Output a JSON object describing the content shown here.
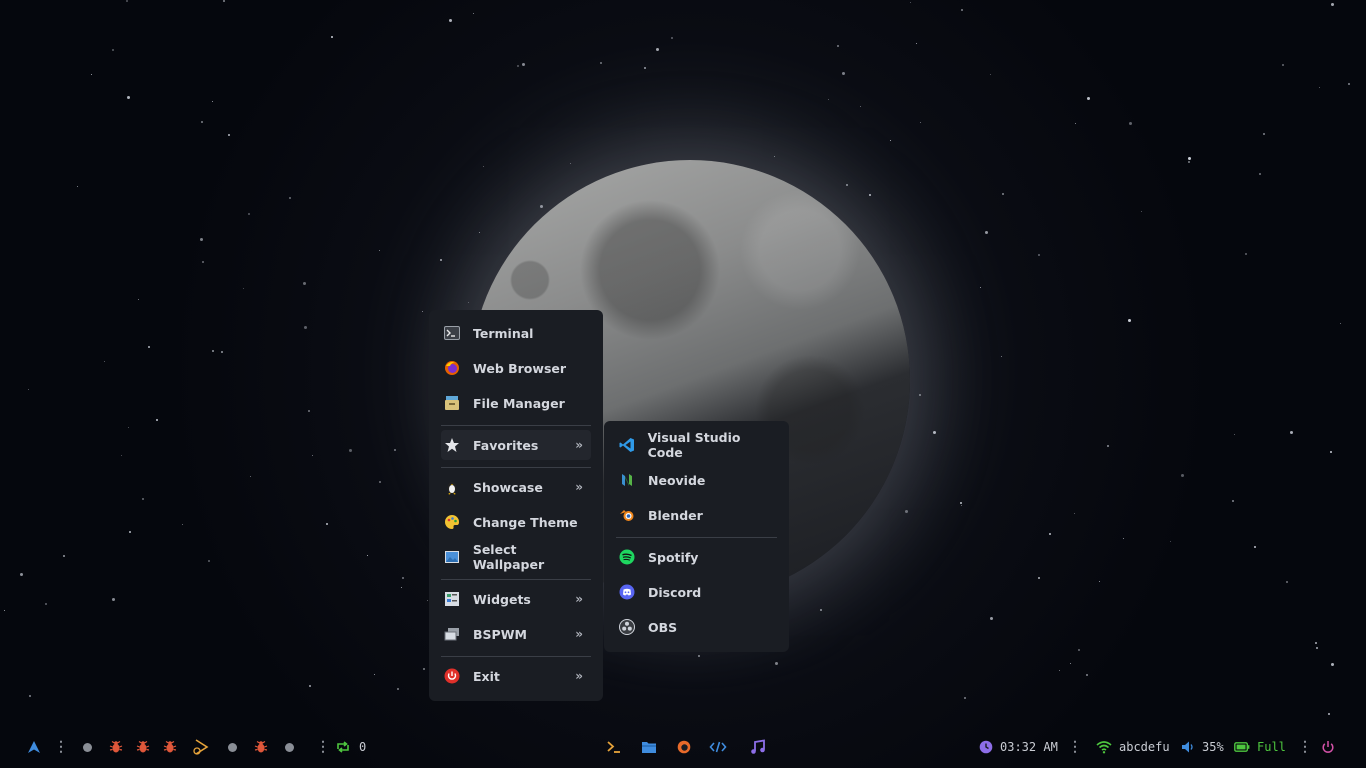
{
  "menu": {
    "items": [
      {
        "label": "Terminal",
        "icon": "terminal-icon"
      },
      {
        "label": "Web Browser",
        "icon": "firefox-icon"
      },
      {
        "label": "File Manager",
        "icon": "file-manager-icon"
      },
      {
        "label": "Favorites",
        "icon": "star-icon",
        "submenu": true
      },
      {
        "label": "Showcase",
        "icon": "linux-penguin-icon",
        "submenu": true
      },
      {
        "label": "Change Theme",
        "icon": "palette-icon"
      },
      {
        "label": "Select Wallpaper",
        "icon": "wallpaper-icon"
      },
      {
        "label": "Widgets",
        "icon": "widgets-icon",
        "submenu": true
      },
      {
        "label": "BSPWM",
        "icon": "bspwm-icon",
        "submenu": true
      },
      {
        "label": "Exit",
        "icon": "power-icon",
        "submenu": true
      }
    ],
    "submenu_arrow": "»"
  },
  "favorites": {
    "items": [
      {
        "label": "Visual Studio Code",
        "icon": "vscode-icon"
      },
      {
        "label": "Neovide",
        "icon": "neovide-icon"
      },
      {
        "label": "Blender",
        "icon": "blender-icon"
      },
      {
        "label": "Spotify",
        "icon": "spotify-icon"
      },
      {
        "label": "Discord",
        "icon": "discord-icon"
      },
      {
        "label": "OBS",
        "icon": "obs-icon"
      }
    ]
  },
  "bar": {
    "updates_count": "0",
    "clock": "03:32 AM",
    "wifi_name": "abcdefu",
    "volume": "35%",
    "battery": "Full"
  },
  "colors": {
    "menu_bg": "#1a1d23",
    "accent_blue": "#4c8ddb",
    "workspace_red": "#e0573a",
    "green": "#4ec63f",
    "purple": "#8d6ee8",
    "orange": "#e6a33a",
    "power_pink": "#d452a8"
  }
}
